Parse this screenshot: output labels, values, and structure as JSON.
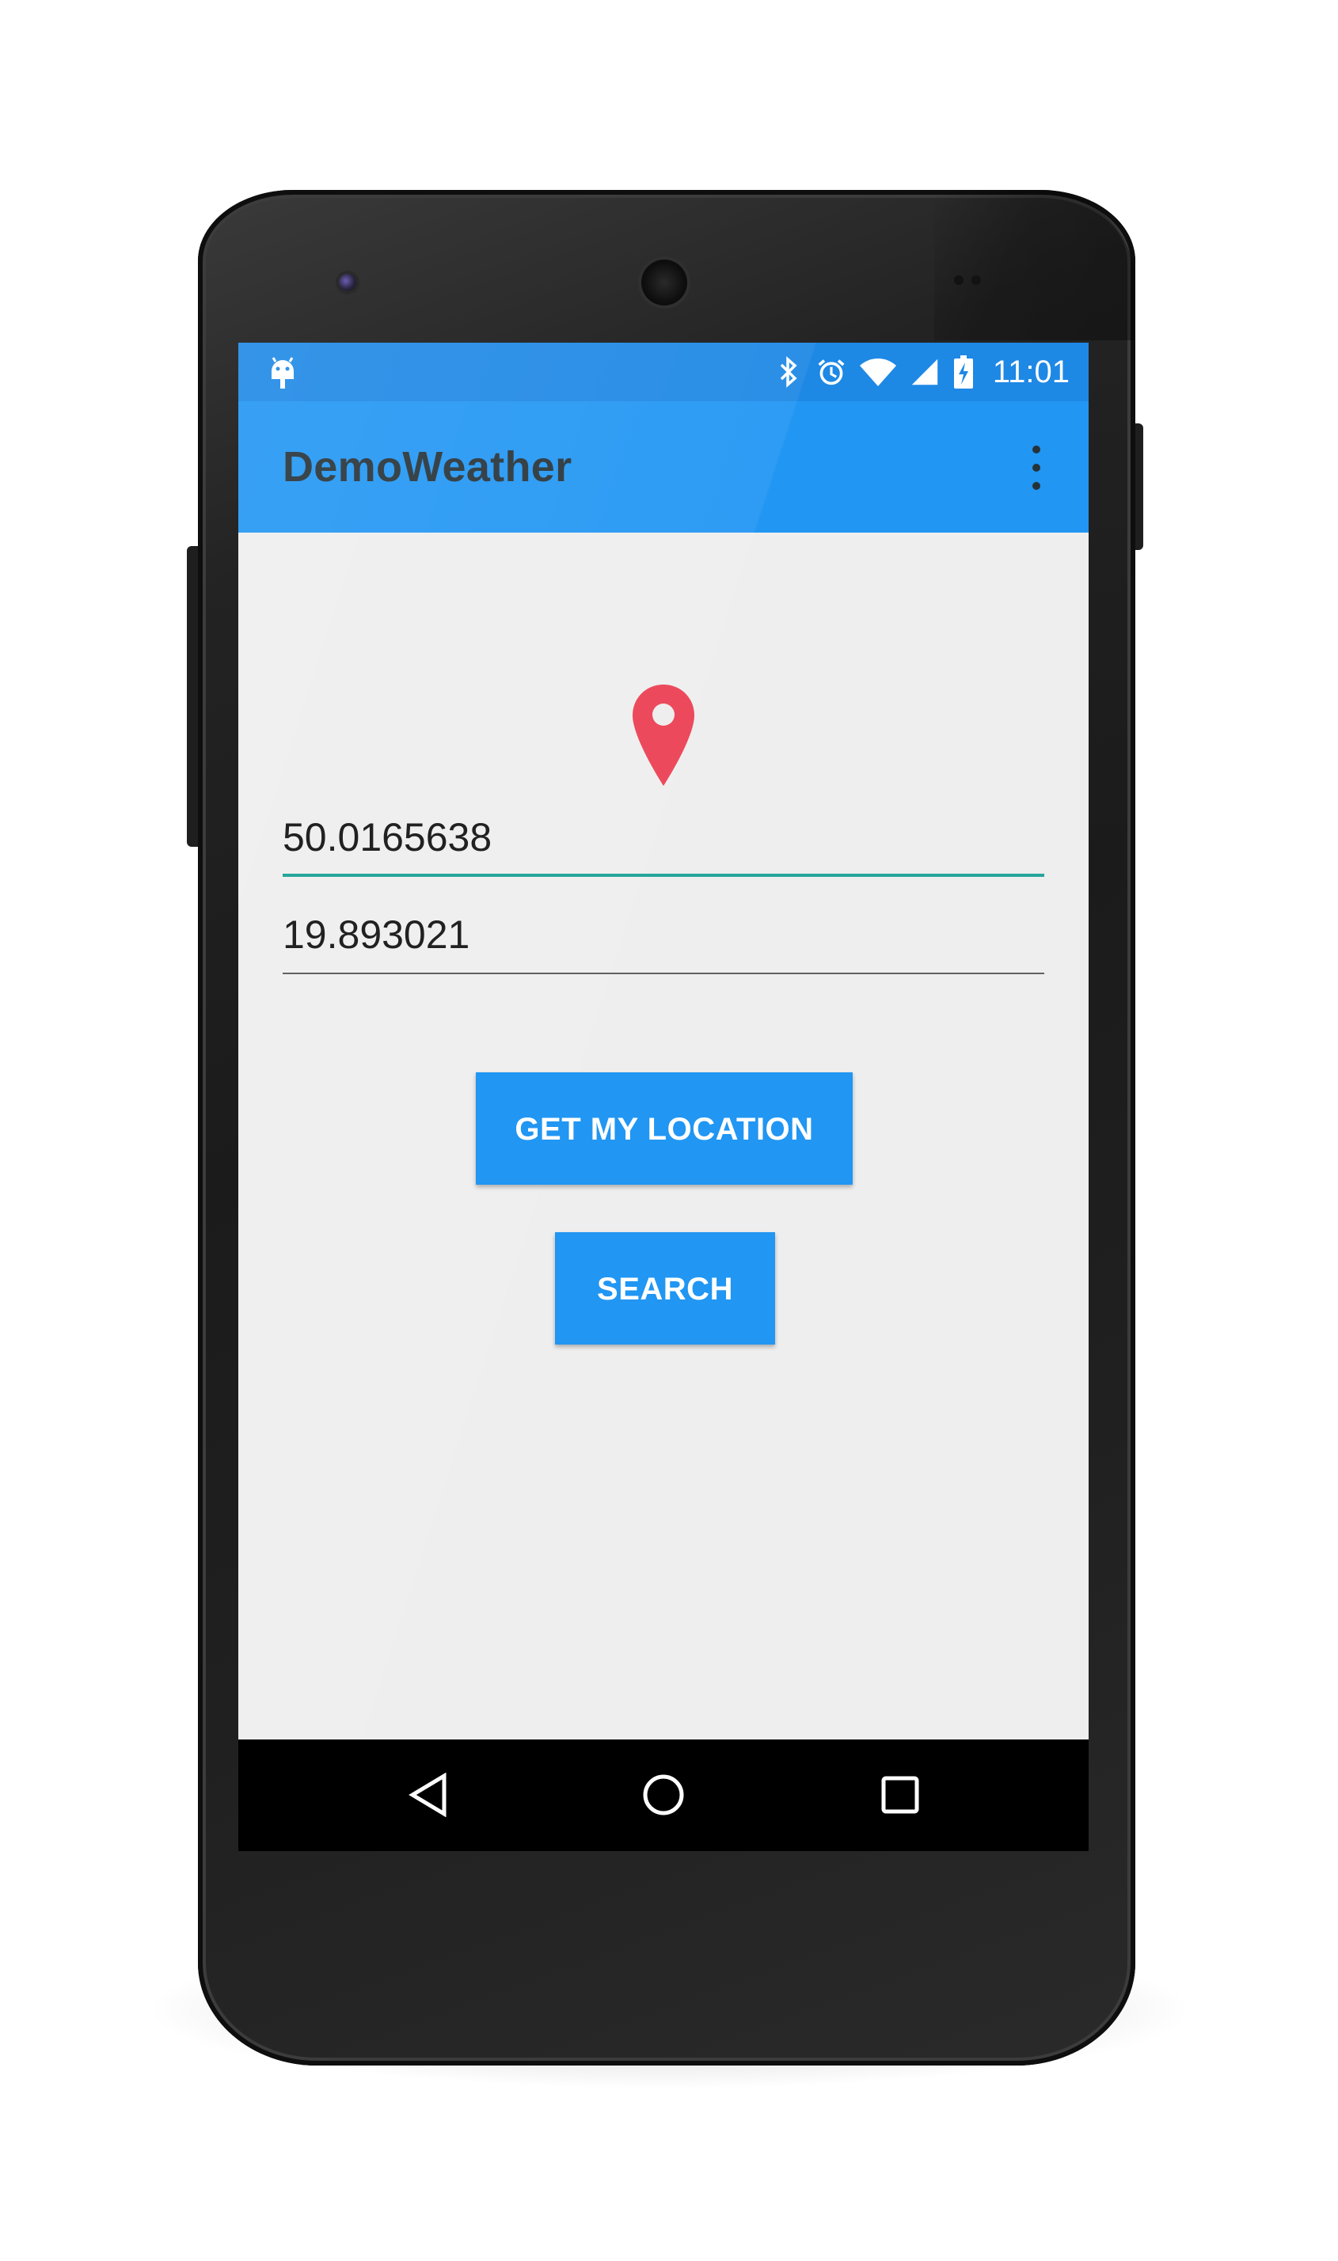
{
  "status_bar": {
    "time": "11:01",
    "icons": [
      "android-notification-icon",
      "bluetooth-icon",
      "alarm-icon",
      "wifi-icon",
      "cell-signal-icon",
      "battery-charging-icon"
    ]
  },
  "app_bar": {
    "title": "DemoWeather",
    "overflow_icon": "more-vert-icon"
  },
  "main": {
    "location_icon": "location-pin-icon",
    "latitude_value": "50.0165638",
    "longitude_value": "19.893021",
    "get_location_label": "GET MY LOCATION",
    "search_label": "SEARCH"
  },
  "nav_bar": {
    "icons": [
      "back-icon",
      "home-icon",
      "recents-icon"
    ]
  },
  "colors": {
    "status_bar": "#1e88e5",
    "app_bar": "#2196f3",
    "accent": "#26a69a",
    "pin": "#ec4a5c",
    "button": "#2196f3",
    "background": "#eeeeee"
  }
}
